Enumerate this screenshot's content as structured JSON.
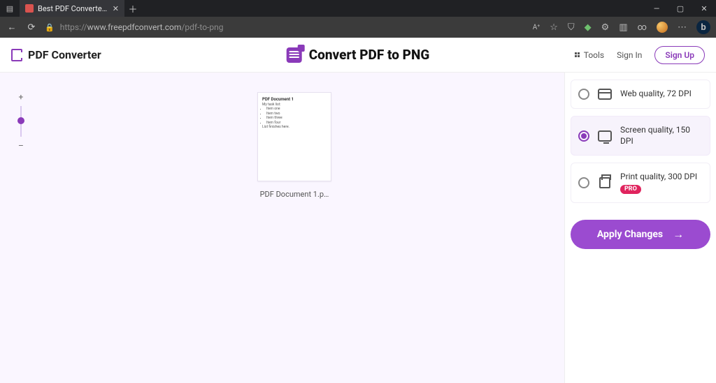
{
  "browser": {
    "tab_title": "Best PDF Converter: Create, Con…",
    "url_prefix": "https://",
    "url_host": "www.freepdfconvert.com",
    "url_path": "/pdf-to-png"
  },
  "header": {
    "brand": "PDF Converter",
    "page_title": "Convert PDF to PNG",
    "tools_label": "Tools",
    "signin_label": "Sign In",
    "signup_label": "Sign Up"
  },
  "zoom": {
    "plus": "+",
    "minus": "–"
  },
  "document": {
    "thumb_title": "PDF Document 1",
    "thumb_lines": [
      "My task list:",
      "Item one",
      "Item two",
      "Item three",
      "Item four",
      "List finishes here."
    ],
    "filename": "PDF Document 1.p…"
  },
  "options": [
    {
      "label": "Web quality, 72 DPI",
      "icon": "web",
      "selected": false,
      "pro": false
    },
    {
      "label": "Screen quality, 150 DPI",
      "icon": "screen",
      "selected": true,
      "pro": false
    },
    {
      "label": "Print quality, 300 DPI",
      "icon": "print",
      "selected": false,
      "pro": true
    }
  ],
  "pro_badge": "PRO",
  "apply_label": "Apply Changes"
}
